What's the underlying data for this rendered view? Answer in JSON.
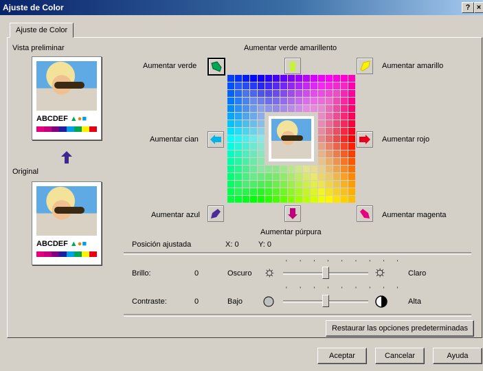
{
  "window": {
    "title": "Ajuste de Color",
    "help_glyph": "?",
    "close_glyph": "×"
  },
  "tab": {
    "label": "Ajuste de Color"
  },
  "preview": {
    "heading": "Vista preliminar",
    "original_label": "Original",
    "sample_text": "ABCDEF",
    "swatch_colors": [
      "#e5007e",
      "#c5007e",
      "#800080",
      "#1e1e9e",
      "#00a0e9",
      "#00a651",
      "#fff100",
      "#e60012"
    ]
  },
  "adjust": {
    "green": "Aumentar verde",
    "green_yellow": "Aumentar verde amarillento",
    "yellow": "Aumentar amarillo",
    "cyan": "Aumentar cian",
    "red": "Aumentar rojo",
    "blue": "Aumentar azul",
    "purple": "Aumentar púrpura",
    "magenta": "Aumentar magenta",
    "colors": {
      "green": "#00a651",
      "green_yellow": "#c8f03c",
      "yellow": "#fff100",
      "cyan": "#00b4e8",
      "red": "#e8001c",
      "blue": "#4a2c9a",
      "purple": "#c0007a",
      "magenta": "#e6007e"
    }
  },
  "position": {
    "label": "Posición ajustada",
    "x_label": "X:",
    "x_value": "0",
    "y_label": "Y:",
    "y_value": "0"
  },
  "brightness": {
    "label": "Brillo:",
    "value": "0",
    "low": "Oscuro",
    "high": "Claro",
    "level": 0
  },
  "contrast": {
    "label": "Contraste:",
    "value": "0",
    "low": "Bajo",
    "high": "Alta",
    "level": 0
  },
  "slider_ticks": "' ' ' ' ' ' ' ' '",
  "buttons": {
    "restore": "Restaurar las opciones predeterminadas",
    "ok": "Aceptar",
    "cancel": "Cancelar",
    "help": "Ayuda"
  }
}
